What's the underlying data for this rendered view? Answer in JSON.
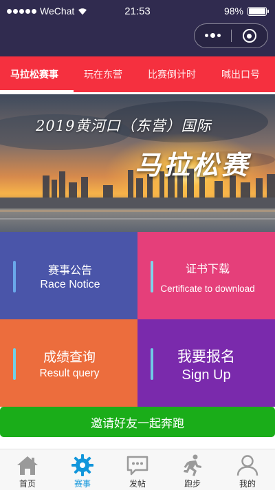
{
  "status_bar": {
    "carrier": "WeChat",
    "time": "21:53",
    "battery_text": "98%",
    "battery_level": 0.98
  },
  "tabs": [
    {
      "label": "马拉松赛事",
      "active": true
    },
    {
      "label": "玩在东营",
      "active": false
    },
    {
      "label": "比赛倒计时",
      "active": false
    },
    {
      "label": "喊出口号",
      "active": false
    }
  ],
  "banner": {
    "title_line1": "2019黄河口（东营）国际",
    "title_line2": "马拉松赛"
  },
  "tiles": [
    {
      "cn": "赛事公告",
      "en": "Race Notice",
      "color": "#4a55a9"
    },
    {
      "cn": "证书下载",
      "en": "Certificate to download",
      "color": "#e53f7a"
    },
    {
      "cn": "成绩查询",
      "en": "Result query",
      "color": "#ec6d3d"
    },
    {
      "cn": "我要报名",
      "en": "Sign Up",
      "color": "#7a2aac"
    }
  ],
  "invite_button": {
    "label": "邀请好友一起奔跑",
    "color": "#1aad19"
  },
  "tabbar": [
    {
      "label": "首页",
      "icon": "home-icon",
      "active": false
    },
    {
      "label": "赛事",
      "icon": "gear-icon",
      "active": true
    },
    {
      "label": "发帖",
      "icon": "message-icon",
      "active": false
    },
    {
      "label": "跑步",
      "icon": "runner-icon",
      "active": false
    },
    {
      "label": "我的",
      "icon": "user-icon",
      "active": false
    }
  ],
  "colors": {
    "header_bg": "#302b4f",
    "tab_bg": "#f5303f",
    "active_tab_label": "#1296db"
  }
}
